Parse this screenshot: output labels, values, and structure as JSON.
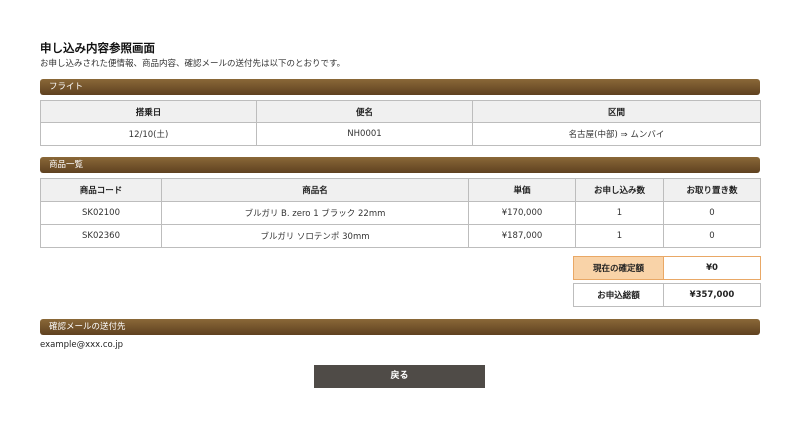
{
  "page": {
    "title": "申し込み内容参照画面",
    "description": "お申し込みされた便情報、商品内容、確認メールの送付先は以下のとおりです。"
  },
  "flight": {
    "section_label": "フライト",
    "headers": [
      "搭乗日",
      "便名",
      "区間"
    ],
    "row": [
      "12/10(土)",
      "NH0001",
      "名古屋(中部) ⇒ ムンバイ"
    ]
  },
  "products": {
    "section_label": "商品一覧",
    "headers": [
      "商品コード",
      "商品名",
      "単価",
      "お申し込み数",
      "お取り置き数"
    ],
    "rows": [
      [
        "SK02100",
        "ブルガリ B. zero 1 ブラック 22mm",
        "¥170,000",
        "1",
        "0"
      ],
      [
        "SK02360",
        "ブルガリ ソロテンポ 30mm",
        "¥187,000",
        "1",
        "0"
      ]
    ]
  },
  "totals": {
    "confirmed_label": "現在の確定額",
    "confirmed_value": "¥0",
    "total_label": "お申込総額",
    "total_value": "¥357,000"
  },
  "email": {
    "section_label": "確認メールの送付先",
    "address": "example@xxx.co.jp"
  },
  "actions": {
    "back_label": "戻る"
  },
  "colors": {
    "section_bar": "#6e4f2a",
    "highlight": "#f9d3a8",
    "button": "#4f4b47"
  }
}
